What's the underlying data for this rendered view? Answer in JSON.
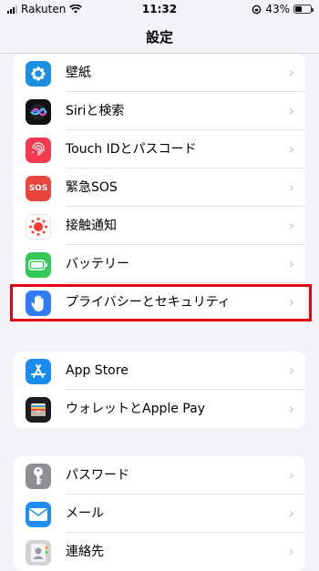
{
  "status": {
    "carrier": "Rakuten",
    "time": "11:32",
    "battery_pct": "43%",
    "battery_level": 0.43
  },
  "nav": {
    "title": "設定"
  },
  "groups": [
    {
      "items": [
        {
          "label": "壁紙",
          "icon": "wallpaper-icon",
          "color": "#1a8fe3"
        },
        {
          "label": "Siriと検索",
          "icon": "siri-icon",
          "color": "#111111"
        },
        {
          "label": "Touch IDとパスコード",
          "icon": "fingerprint-icon",
          "color": "#f2394f"
        },
        {
          "label": "緊急SOS",
          "icon": "sos-icon",
          "color": "#e8453c",
          "icon_text": "SOS"
        },
        {
          "label": "接触通知",
          "icon": "exposure-notification-icon",
          "color": "#ffffff"
        },
        {
          "label": "バッテリー",
          "icon": "battery-icon",
          "color": "#34c759"
        },
        {
          "label": "プライバシーとセキュリティ",
          "icon": "hand-icon",
          "color": "#2f7cf6"
        }
      ]
    },
    {
      "items": [
        {
          "label": "App Store",
          "icon": "app-store-icon",
          "color": "#1a8cf0"
        },
        {
          "label": "ウォレットとApple Pay",
          "icon": "wallet-icon",
          "color": "#1c1c1e"
        }
      ]
    },
    {
      "items": [
        {
          "label": "パスワード",
          "icon": "key-icon",
          "color": "#8e8e93"
        },
        {
          "label": "メール",
          "icon": "mail-icon",
          "color": "#1f8ef1"
        },
        {
          "label": "連絡先",
          "icon": "contacts-icon",
          "color": "#d1d1d6"
        }
      ]
    }
  ],
  "chevron": "›"
}
